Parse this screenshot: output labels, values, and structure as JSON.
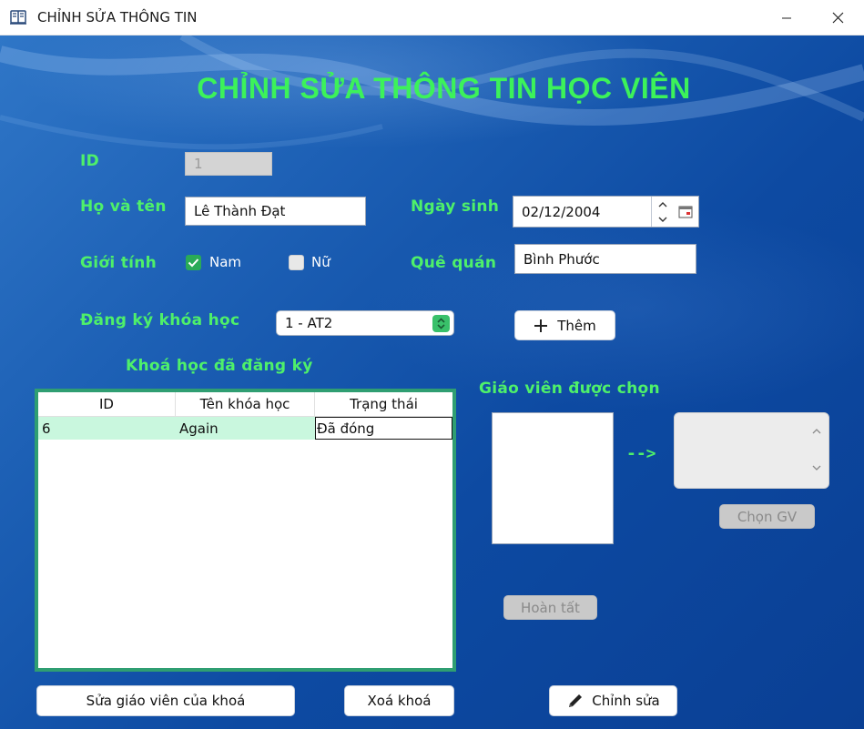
{
  "window": {
    "title": "CHỈNH SỬA THÔNG TIN",
    "app_icon": "book-logo-icon",
    "minimize_icon": "minimize-icon",
    "close_icon": "close-icon"
  },
  "page": {
    "heading": "CHỈNH SỬA THÔNG TIN HỌC VIÊN"
  },
  "form": {
    "id_label": "ID",
    "id_value": "1",
    "name_label": "Họ và tên",
    "name_value": "Lê Thành Đạt",
    "dob_label": "Ngày sinh",
    "dob_value": "02/12/2004",
    "gender_label": "Giới tính",
    "gender_options": [
      {
        "label": "Nam",
        "checked": true
      },
      {
        "label": "Nữ",
        "checked": false
      }
    ],
    "hometown_label": "Quê quán",
    "hometown_value": "Bình Phước",
    "course_label": "Đăng ký khóa học",
    "course_selected": "1 - AT2",
    "add_button": "Thêm"
  },
  "registered": {
    "title": "Khoá học đã đăng ký",
    "columns": [
      "ID",
      "Tên khóa học",
      "Trạng thái"
    ],
    "rows": [
      [
        "6",
        "Again",
        "Đã đóng"
      ]
    ]
  },
  "teacher": {
    "title": "Giáo viên được chọn",
    "arrow": "-->",
    "choose_button": "Chọn GV",
    "done_button": "Hoàn tất"
  },
  "footer": {
    "edit_teacher_button": "Sửa giáo viên của khoá",
    "delete_course_button": "Xoá khoá",
    "edit_button": "Chỉnh sửa"
  },
  "colors": {
    "accent_green": "#4ef06a",
    "background_blue": "#1c5fb4",
    "table_border": "#2f9e72",
    "selected_row": "#c9f7de"
  }
}
